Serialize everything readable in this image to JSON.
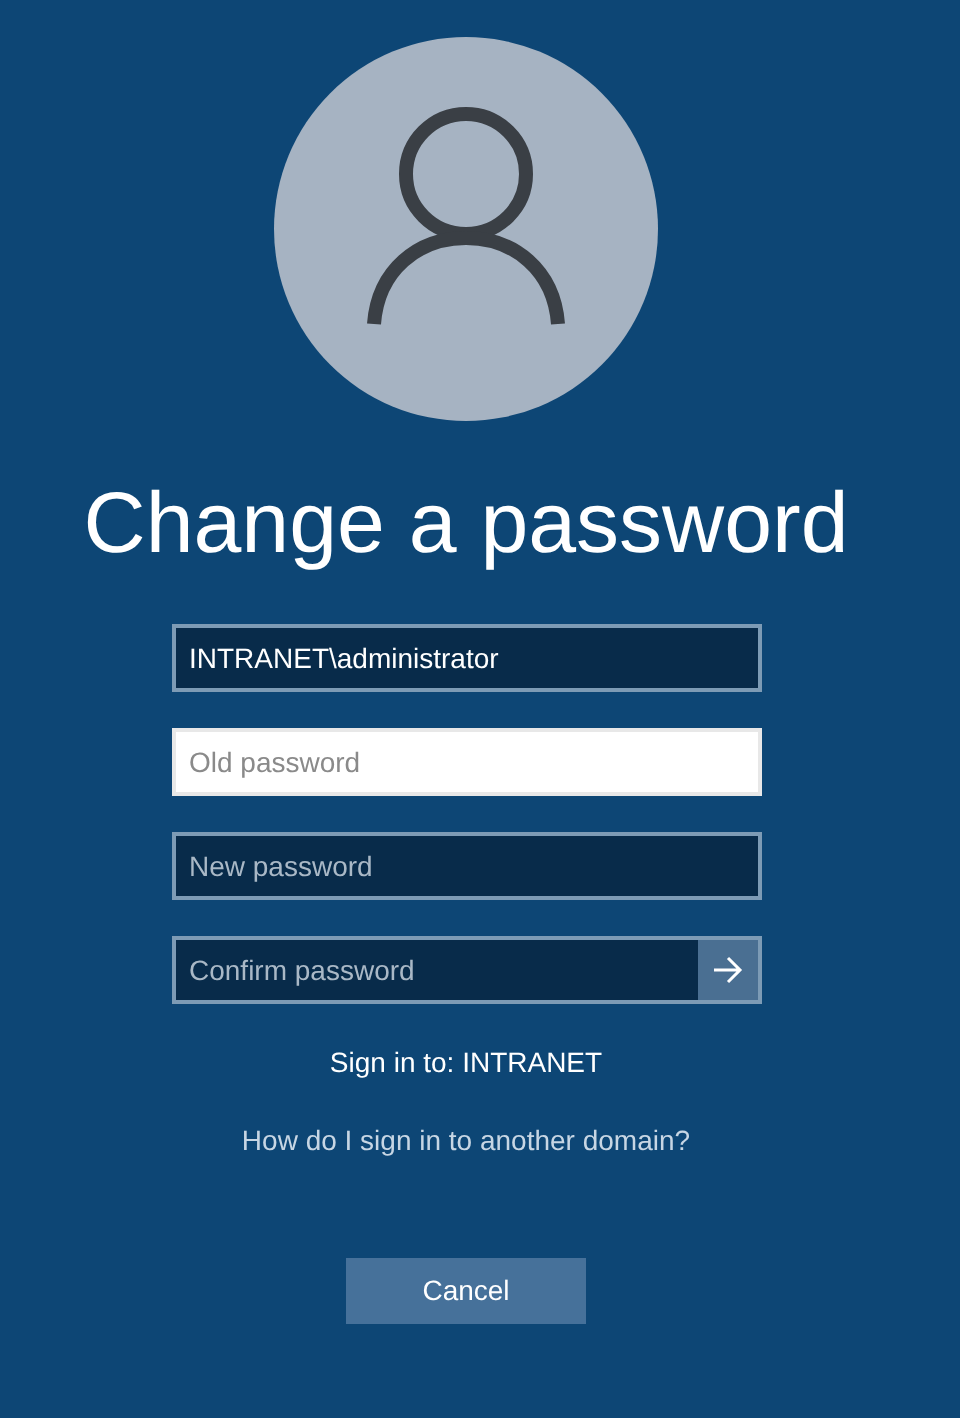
{
  "title": "Change a password",
  "fields": [
    {
      "value": "INTRANET\\administrator",
      "focused": false,
      "submit": false
    },
    {
      "placeholder": "Old password",
      "focused": true,
      "submit": false
    },
    {
      "placeholder": "New password",
      "focused": false,
      "submit": false
    },
    {
      "placeholder": "Confirm password",
      "focused": false,
      "submit": true
    }
  ],
  "sign_in_to": "Sign in to: INTRANET",
  "help_link": "How do I sign in to another domain?",
  "cancel_button": "Cancel"
}
